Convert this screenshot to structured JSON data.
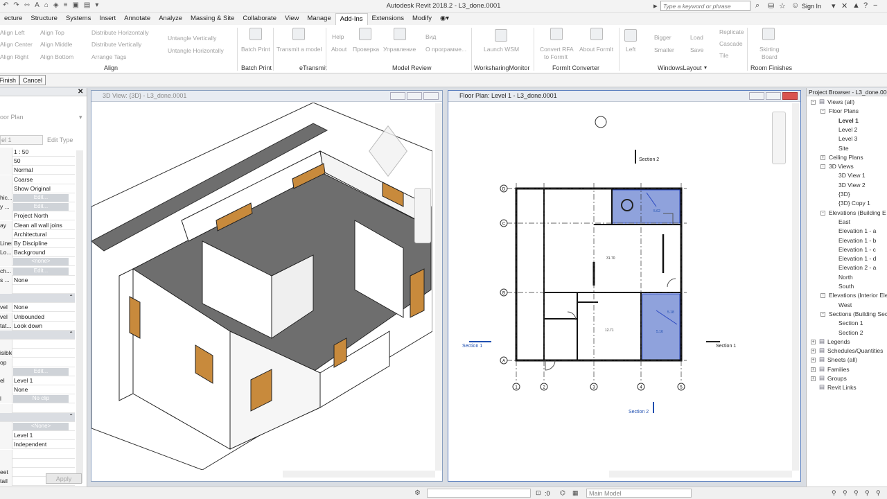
{
  "app": {
    "title": "Autodesk Revit 2018.2 -   L3_done.0001",
    "search_placeholder": "Type a keyword or phrase",
    "signin": "Sign In"
  },
  "tabs": [
    "ecture",
    "Structure",
    "Systems",
    "Insert",
    "Annotate",
    "Analyze",
    "Massing & Site",
    "Collaborate",
    "View",
    "Manage",
    "Add-Ins",
    "Extensions",
    "Modify"
  ],
  "active_tab": "Add-Ins",
  "ribbon": {
    "align": {
      "items": [
        "Align Left",
        "Align Top",
        "Distribute Horizontally",
        "Align Center",
        "Align Middle",
        "Distribute Vertically",
        "Align Right",
        "Align Bottom",
        "Arrange Tags",
        "Untangle Vertically",
        "Untangle Horizontally"
      ],
      "label": "Align"
    },
    "batch": {
      "item": "Batch Print",
      "label": "Batch Print"
    },
    "etransmit": {
      "item": "Transmit a model",
      "label": "eTransmit"
    },
    "model_review": {
      "items": [
        "Help",
        "About",
        "Проверка",
        "Управление",
        "Вид",
        "О программе..."
      ],
      "label": "Model Review"
    },
    "wsm": {
      "item": "Launch WSM",
      "label": "WorksharingMonitor"
    },
    "formit": {
      "items": [
        "Convert RFA",
        "to FormIt",
        "About FormIt"
      ],
      "label": "FormIt Converter"
    },
    "windows": {
      "items": [
        "Left",
        "Bigger",
        "Smaller",
        "Load",
        "Save",
        "Replicate",
        "Cascade",
        "Tile"
      ],
      "label": "WindowsLayout"
    },
    "room": {
      "items": [
        "Skirting",
        "Board"
      ],
      "label": "Room Finishes"
    }
  },
  "options": {
    "finish": "Finish",
    "cancel": "Cancel"
  },
  "properties": {
    "type": "oor Plan",
    "level": "el 1",
    "edit_type": "Edit Type",
    "rows": [
      {
        "l": "",
        "v": "1 : 50"
      },
      {
        "l": "",
        "v": "50"
      },
      {
        "l": "",
        "v": "Normal"
      },
      {
        "l": "",
        "v": "Coarse"
      },
      {
        "l": "",
        "v": "Show Original"
      },
      {
        "l": "hic...",
        "btn": "Edit..."
      },
      {
        "l": "y ...",
        "btn": "Edit..."
      },
      {
        "l": "",
        "v": "Project North"
      },
      {
        "l": "ay",
        "v": "Clean all wall joins"
      },
      {
        "l": "",
        "v": "Architectural"
      },
      {
        "l": "Lines",
        "v": "By Discipline"
      },
      {
        "l": "Lo...",
        "v": "Background"
      },
      {
        "l": "",
        "btn": "<none>"
      },
      {
        "l": "ch...",
        "btn": "Edit..."
      },
      {
        "l": "s ...",
        "v": "None"
      },
      {
        "l": "",
        "v": ""
      },
      {
        "grp": true
      },
      {
        "l": "vel",
        "v": "None"
      },
      {
        "l": "vel",
        "v": "Unbounded"
      },
      {
        "l": "tat...",
        "v": "Look down"
      },
      {
        "grp": true
      },
      {
        "l": "",
        "v": ""
      },
      {
        "l": "isible",
        "v": ""
      },
      {
        "l": "op",
        "v": ""
      },
      {
        "l": "",
        "btn": "Edit..."
      },
      {
        "l": "el",
        "v": "Level 1"
      },
      {
        "l": "",
        "v": "None"
      },
      {
        "l": "l",
        "btn": "No clip"
      },
      {
        "l": "",
        "v": ""
      },
      {
        "grp": true
      },
      {
        "l": "",
        "btn": "<None>"
      },
      {
        "l": "",
        "v": "Level 1"
      },
      {
        "l": "",
        "v": "Independent"
      },
      {
        "l": "",
        "v": ""
      },
      {
        "l": "",
        "v": ""
      },
      {
        "l": "eet",
        "v": ""
      },
      {
        "l": "tail",
        "v": ""
      }
    ],
    "apply": "Apply"
  },
  "view3d": {
    "title": "3D View: {3D} - L3_done.0001"
  },
  "plan": {
    "title": "Floor Plan: Level 1 - L3_done.0001",
    "grid_rows": [
      "D",
      "C",
      "B",
      "A"
    ],
    "grid_cols": [
      "1",
      "2",
      "3",
      "4",
      "5"
    ],
    "section1": "Section 1",
    "section2": "Section 2",
    "areas": [
      "31.70",
      "12.71",
      "5.62",
      "5.18",
      "5.16"
    ]
  },
  "browser": {
    "title": "Project Browser - L3_done.0001",
    "items": [
      {
        "t": "Views (all)",
        "d": 0,
        "tog": "-"
      },
      {
        "t": "Floor Plans",
        "d": 1,
        "tog": "-"
      },
      {
        "t": "Level 1",
        "d": 2,
        "bold": true
      },
      {
        "t": "Level 2",
        "d": 2
      },
      {
        "t": "Level 3",
        "d": 2
      },
      {
        "t": "Site",
        "d": 2
      },
      {
        "t": "Ceiling Plans",
        "d": 1,
        "tog": "+"
      },
      {
        "t": "3D Views",
        "d": 1,
        "tog": "-"
      },
      {
        "t": "3D View 1",
        "d": 2
      },
      {
        "t": "3D View 2",
        "d": 2
      },
      {
        "t": "{3D}",
        "d": 2
      },
      {
        "t": "{3D} Copy 1",
        "d": 2
      },
      {
        "t": "Elevations (Building E",
        "d": 1,
        "tog": "-"
      },
      {
        "t": "East",
        "d": 2
      },
      {
        "t": "Elevation 1 - a",
        "d": 2
      },
      {
        "t": "Elevation 1 - b",
        "d": 2
      },
      {
        "t": "Elevation 1 - c",
        "d": 2
      },
      {
        "t": "Elevation 1 - d",
        "d": 2
      },
      {
        "t": "Elevation 2 - a",
        "d": 2
      },
      {
        "t": "North",
        "d": 2
      },
      {
        "t": "South",
        "d": 2
      },
      {
        "t": "Elevations (Interior Ele",
        "d": 1,
        "tog": "-"
      },
      {
        "t": "West",
        "d": 2
      },
      {
        "t": "Sections (Building Sec",
        "d": 1,
        "tog": "-"
      },
      {
        "t": "Section 1",
        "d": 2
      },
      {
        "t": "Section 2",
        "d": 2
      },
      {
        "t": "Legends",
        "d": 0,
        "tog": "+"
      },
      {
        "t": "Schedules/Quantities",
        "d": 0,
        "tog": "+"
      },
      {
        "t": "Sheets (all)",
        "d": 0,
        "tog": "+"
      },
      {
        "t": "Families",
        "d": 0,
        "tog": "+"
      },
      {
        "t": "Groups",
        "d": 0,
        "tog": "+"
      },
      {
        "t": "Revit Links",
        "d": 0,
        "tog": ""
      }
    ]
  },
  "status": {
    "zero": ":0",
    "model": "Main Model"
  },
  "colors": {
    "room_fill": "#8fa2dc",
    "wall3d": "#ffffff",
    "floor3d": "#6e6e6e",
    "door": "#c88a3c"
  }
}
